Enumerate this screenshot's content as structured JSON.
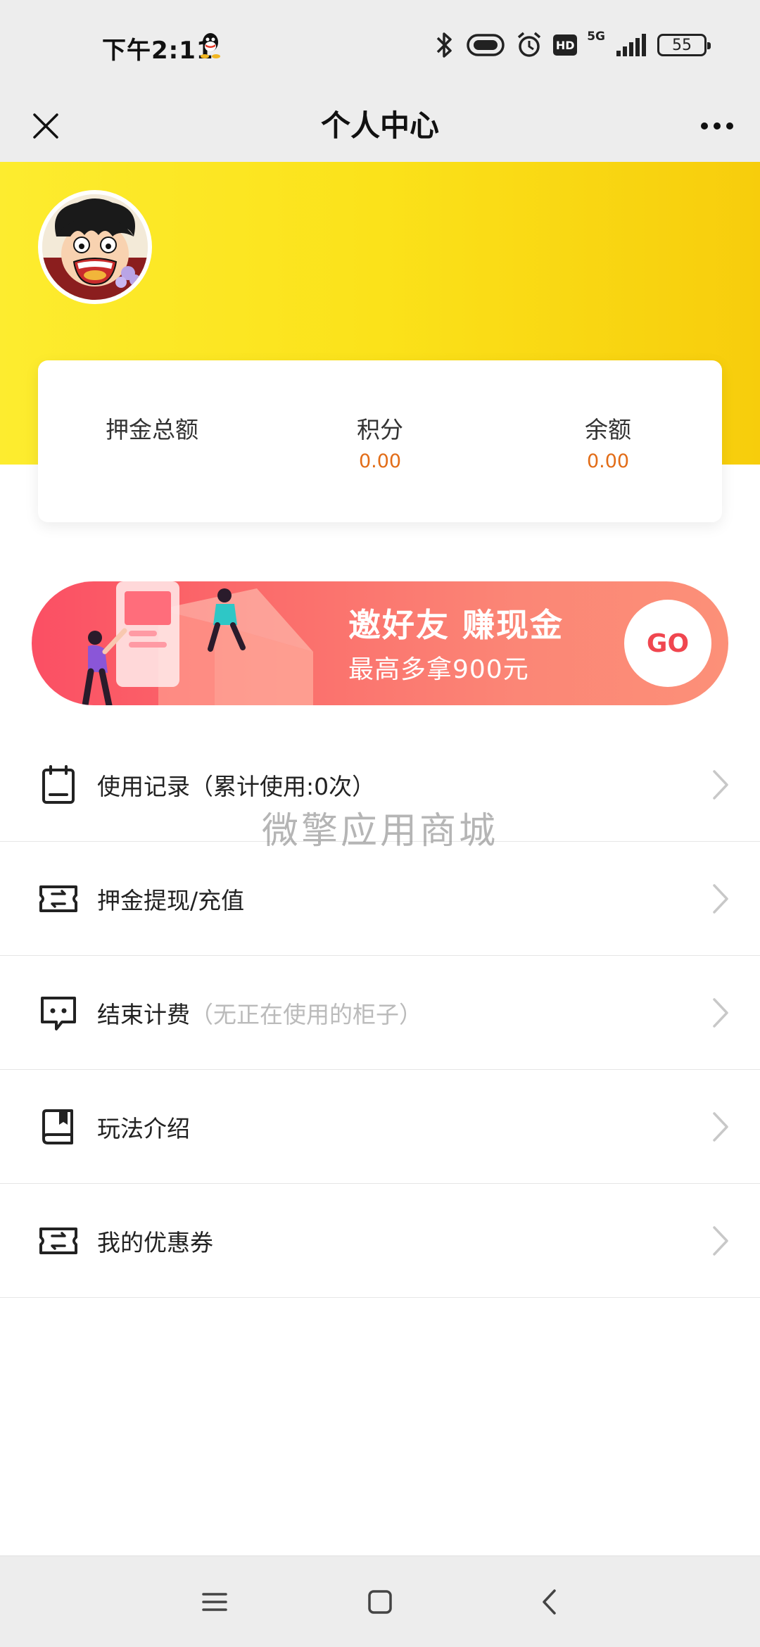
{
  "status_bar": {
    "time": "下午2:11",
    "network": "5G",
    "hd": "HD",
    "battery": "55"
  },
  "nav": {
    "title": "个人中心",
    "close_icon": "close-icon",
    "more_icon": "more-icon"
  },
  "stats": {
    "deposit_label": "押金总额",
    "points_label": "积分",
    "points_value": "0.00",
    "balance_label": "余额",
    "balance_value": "0.00",
    "value_color": "#e26d18"
  },
  "banner": {
    "title": "邀好友 赚现金",
    "subtitle": "最高多拿900元",
    "go": "GO"
  },
  "menu": {
    "items": [
      {
        "label": "使用记录（累计使用:0次）",
        "hint": "",
        "icon": "calendar-icon"
      },
      {
        "label": "押金提现/充值",
        "hint": "",
        "icon": "ticket-icon"
      },
      {
        "label": "结束计费",
        "hint": "（无正在使用的柜子）",
        "icon": "message-icon"
      },
      {
        "label": "玩法介绍",
        "hint": "",
        "icon": "book-icon"
      },
      {
        "label": "我的优惠券",
        "hint": "",
        "icon": "ticket-icon"
      }
    ]
  },
  "watermark": "微擎应用商城",
  "colors": {
    "header_yellow": "#fbe21a",
    "banner_red": "#fb5866",
    "accent_orange": "#e26d18"
  }
}
